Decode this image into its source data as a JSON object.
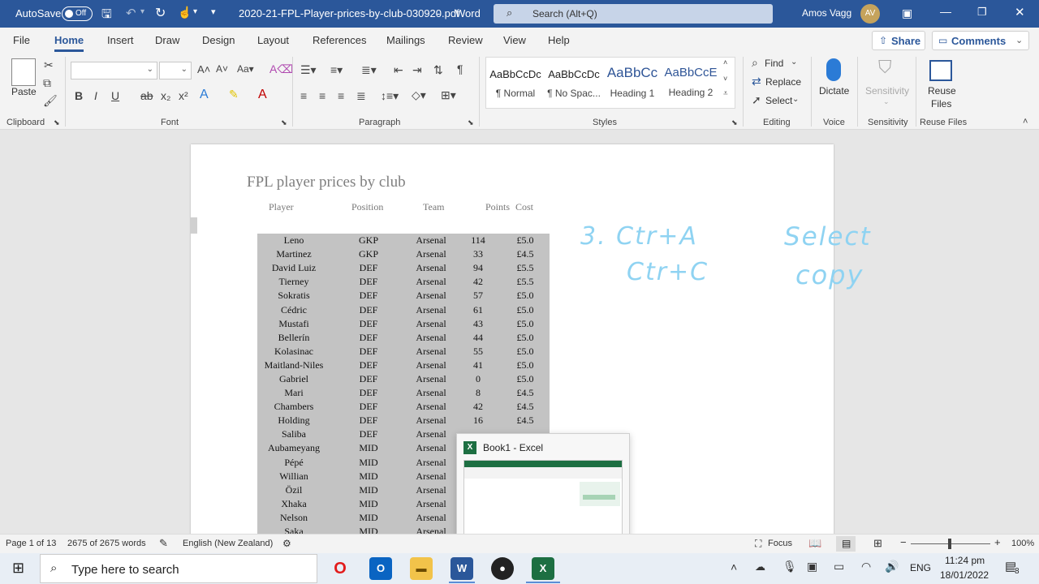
{
  "titlebar": {
    "autosave_label": "AutoSave",
    "autosave_state": "Off",
    "filename": "2020-21-FPL-Player-prices-by-club-030920.pdf",
    "app": "Word",
    "search_placeholder": "Search (Alt+Q)",
    "user_name": "Amos Vagg",
    "user_initials": "AV"
  },
  "tabs": [
    "File",
    "Home",
    "Insert",
    "Draw",
    "Design",
    "Layout",
    "References",
    "Mailings",
    "Review",
    "View",
    "Help"
  ],
  "share_label": "Share",
  "comments_label": "Comments",
  "ribbon": {
    "clipboard": {
      "paste": "Paste",
      "group": "Clipboard"
    },
    "font": {
      "group": "Font"
    },
    "paragraph": {
      "group": "Paragraph"
    },
    "styles": {
      "group": "Styles",
      "items": [
        {
          "sample": "AaBbCcDc",
          "name": "¶ Normal"
        },
        {
          "sample": "AaBbCcDc",
          "name": "¶ No Spac..."
        },
        {
          "sample": "AaBbCc",
          "name": "Heading 1"
        },
        {
          "sample": "AaBbCcE",
          "name": "Heading 2"
        }
      ]
    },
    "editing": {
      "find": "Find",
      "replace": "Replace",
      "select": "Select",
      "group": "Editing"
    },
    "voice": {
      "dictate": "Dictate",
      "group": "Voice"
    },
    "sensitivity": {
      "button": "Sensitivity",
      "group": "Sensitivity"
    },
    "reuse": {
      "button_line1": "Reuse",
      "button_line2": "Files",
      "group": "Reuse Files"
    }
  },
  "document": {
    "title": "FPL player prices by club",
    "headers": [
      "Player",
      "Position",
      "Team",
      "Points",
      "Cost"
    ],
    "rows": [
      [
        "Leno",
        "GKP",
        "Arsenal",
        "114",
        "£5.0"
      ],
      [
        "Martinez",
        "GKP",
        "Arsenal",
        "33",
        "£4.5"
      ],
      [
        "David Luiz",
        "DEF",
        "Arsenal",
        "94",
        "£5.5"
      ],
      [
        "Tierney",
        "DEF",
        "Arsenal",
        "42",
        "£5.5"
      ],
      [
        "Sokratis",
        "DEF",
        "Arsenal",
        "57",
        "£5.0"
      ],
      [
        "Cédric",
        "DEF",
        "Arsenal",
        "61",
        "£5.0"
      ],
      [
        "Mustafi",
        "DEF",
        "Arsenal",
        "43",
        "£5.0"
      ],
      [
        "Bellerín",
        "DEF",
        "Arsenal",
        "44",
        "£5.0"
      ],
      [
        "Kolasinac",
        "DEF",
        "Arsenal",
        "55",
        "£5.0"
      ],
      [
        "Maitland-Niles",
        "DEF",
        "Arsenal",
        "41",
        "£5.0"
      ],
      [
        "Gabriel",
        "DEF",
        "Arsenal",
        "0",
        "£5.0"
      ],
      [
        "Mari",
        "DEF",
        "Arsenal",
        "8",
        "£4.5"
      ],
      [
        "Chambers",
        "DEF",
        "Arsenal",
        "42",
        "£4.5"
      ],
      [
        "Holding",
        "DEF",
        "Arsenal",
        "16",
        "£4.5"
      ],
      [
        "Saliba",
        "DEF",
        "Arsenal",
        "",
        ""
      ],
      [
        "Aubameyang",
        "MID",
        "Arsenal",
        "",
        ""
      ],
      [
        "Pépé",
        "MID",
        "Arsenal",
        "",
        ""
      ],
      [
        "Willian",
        "MID",
        "Arsenal",
        "",
        ""
      ],
      [
        "Özil",
        "MID",
        "Arsenal",
        "",
        ""
      ],
      [
        "Xhaka",
        "MID",
        "Arsenal",
        "",
        ""
      ],
      [
        "Nelson",
        "MID",
        "Arsenal",
        "",
        ""
      ],
      [
        "Saka",
        "MID",
        "Arsenal",
        "",
        ""
      ]
    ]
  },
  "ink": {
    "line1": "3. Ctr+A",
    "line2": "Ctr+C",
    "word1": "Select",
    "word2": "copy"
  },
  "taskbar_preview": {
    "title": "Book1 - Excel"
  },
  "statusbar": {
    "page": "Page 1 of 13",
    "words": "2675 of 2675 words",
    "language": "English (New Zealand)",
    "focus": "Focus",
    "zoom": "100%"
  },
  "taskbar": {
    "search_placeholder": "Type here to search",
    "lang": "ENG",
    "time": "11:24 pm",
    "date": "18/01/2022",
    "notif_count": "8"
  },
  "colors": {
    "word_blue": "#2b579a",
    "excel_green": "#1d6f42",
    "ink": "#8fd3f2",
    "table_bg": "#c3c3c3"
  }
}
